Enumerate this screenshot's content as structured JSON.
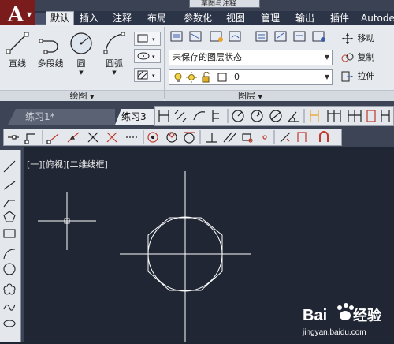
{
  "app": {
    "logo_letter": "A",
    "file_name": "草图与注释"
  },
  "ribbon_tabs": [
    {
      "label": "默认",
      "active": true
    },
    {
      "label": "插入"
    },
    {
      "label": "注释"
    },
    {
      "label": "布局"
    },
    {
      "label": "参数化"
    },
    {
      "label": "视图"
    },
    {
      "label": "管理"
    },
    {
      "label": "输出"
    },
    {
      "label": "插件"
    },
    {
      "label": "Autode"
    }
  ],
  "draw_panel": {
    "title": "绘图",
    "tools": [
      {
        "label": "直线",
        "icon": "line-icon"
      },
      {
        "label": "多段线",
        "icon": "polyline-icon"
      },
      {
        "label": "圆",
        "icon": "circle-icon"
      },
      {
        "label": "圆弧",
        "icon": "arc-icon"
      }
    ]
  },
  "layers_panel": {
    "title": "图层",
    "layer_state": "未保存的图层状态",
    "current_layer": "0"
  },
  "modify_panel": {
    "tools": [
      {
        "label": "移动",
        "icon": "move-icon"
      },
      {
        "label": "复制",
        "icon": "copy-icon"
      },
      {
        "label": "拉伸",
        "icon": "stretch-icon"
      }
    ]
  },
  "documents": [
    {
      "label": "练习1*",
      "active": false
    },
    {
      "label": "练习3",
      "active": true
    }
  ],
  "viewport": {
    "label": "[一][俯视][二维线框]"
  },
  "colors": {
    "canvas": "#202634",
    "drawing": "#ffffff",
    "ribbon": "#e6e9ee",
    "accent": "#7a1c1c"
  },
  "watermark": {
    "brand": "Bai经验",
    "url": "jingyan.baidu.com"
  }
}
